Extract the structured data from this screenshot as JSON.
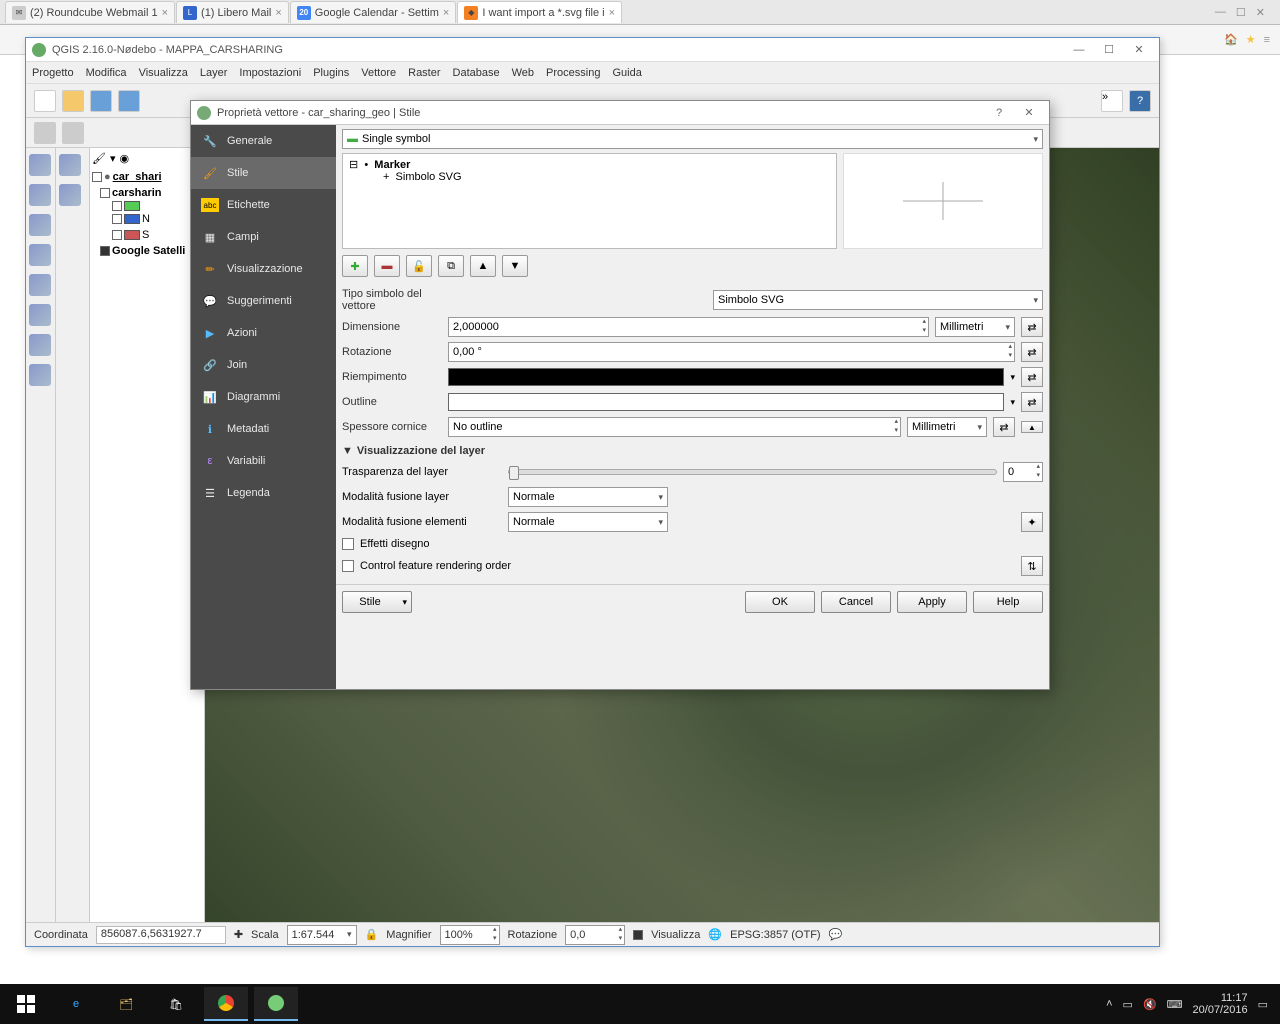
{
  "browser": {
    "tabs": [
      {
        "title": "(2) Roundcube Webmail 1"
      },
      {
        "title": "(1) Libero Mail"
      },
      {
        "title": "Google Calendar - Settim",
        "badge": "20"
      },
      {
        "title": "I want import a *.svg file i"
      }
    ],
    "win": {
      "min": "—",
      "max": "☐",
      "close": "✕"
    }
  },
  "qgis": {
    "title": "QGIS 2.16.0-Nødebo - MAPPA_CARSHARING",
    "menu": [
      "Progetto",
      "Modifica",
      "Visualizza",
      "Layer",
      "Impostazioni",
      "Plugins",
      "Vettore",
      "Raster",
      "Database",
      "Web",
      "Processing",
      "Guida"
    ],
    "layers": {
      "l0": "car_shari",
      "l1": "carsharin",
      "l2": "N",
      "l3": "S",
      "l4": "Google Satelli"
    },
    "status": {
      "coord_lbl": "Coordinata",
      "coord_val": "856087.6,5631927.7",
      "scale_lbl": "Scala",
      "scale_val": "1:67.544",
      "mag_lbl": "Magnifier",
      "mag_val": "100%",
      "rot_lbl": "Rotazione",
      "rot_val": "0,0",
      "vis_lbl": "Visualizza",
      "crs": "EPSG:3857 (OTF)"
    }
  },
  "dialog": {
    "title": "Proprietà vettore - car_sharing_geo | Stile",
    "help": "?",
    "close": "✕",
    "side": {
      "generale": "Generale",
      "stile": "Stile",
      "etichette": "Etichette",
      "campi": "Campi",
      "visualizzazione": "Visualizzazione",
      "suggerimenti": "Suggerimenti",
      "azioni": "Azioni",
      "join": "Join",
      "diagrammi": "Diagrammi",
      "metadati": "Metadati",
      "variabili": "Variabili",
      "legenda": "Legenda"
    },
    "single_symbol": "Single symbol",
    "tree": {
      "marker": "Marker",
      "svg": "Simbolo SVG"
    },
    "form": {
      "tipo_lbl": "Tipo simbolo del vettore",
      "tipo_val": "Simbolo SVG",
      "dim_lbl": "Dimensione",
      "dim_val": "2,000000",
      "dim_unit": "Millimetri",
      "rot_lbl": "Rotazione",
      "rot_val": "0,00 °",
      "riemp_lbl": "Riempimento",
      "outline_lbl": "Outline",
      "spess_lbl": "Spessore cornice",
      "spess_val": "No outline",
      "spess_unit": "Millimetri"
    },
    "layer_viz": {
      "header": "Visualizzazione del layer",
      "trasp_lbl": "Trasparenza del layer",
      "trasp_val": "0",
      "blend_layer_lbl": "Modalità fusione layer",
      "blend_layer_val": "Normale",
      "blend_feat_lbl": "Modalità fusione elementi",
      "blend_feat_val": "Normale",
      "effetti": "Effetti disegno",
      "ordering": "Control feature rendering order"
    },
    "buttons": {
      "stile": "Stile",
      "ok": "OK",
      "cancel": "Cancel",
      "apply": "Apply",
      "help": "Help"
    }
  },
  "taskbar": {
    "time": "11:17",
    "date": "20/07/2016"
  },
  "colors": {
    "fill": "#000000",
    "outline": "#ffffff"
  }
}
